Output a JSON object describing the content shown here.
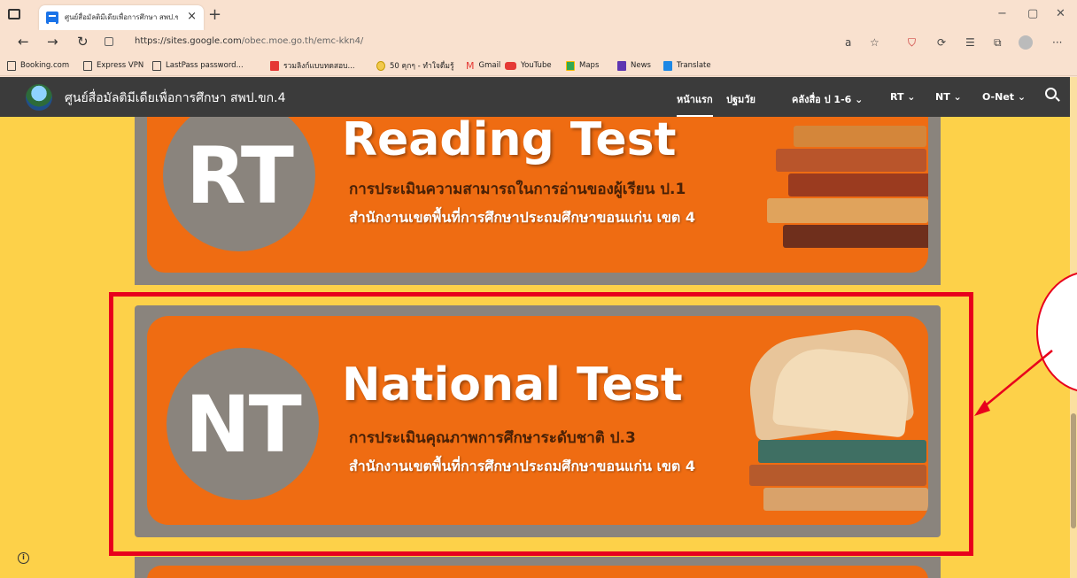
{
  "browser": {
    "tab_title": "ศูนย์สื่อมัลติมีเดียเพื่อการศึกษา สพป.ข",
    "tab_close": "×",
    "new_tab": "+",
    "url_main": "https://sites.google.com",
    "url_path": "/obec.moe.go.th/emc-kkn4/",
    "window_controls": [
      "−",
      "▢",
      "✕"
    ],
    "nav_icons": [
      "back-icon",
      "forward-icon",
      "refresh-icon"
    ],
    "toolbar_icons": [
      "read-aloud-icon",
      "favorite-icon",
      "shield-icon",
      "extension-icon",
      "collections-icon",
      "profile-icon",
      "more-icon"
    ]
  },
  "bookmarks": [
    {
      "label": "Booking.com",
      "icon": "page"
    },
    {
      "label": "Express VPN",
      "icon": "page"
    },
    {
      "label": "LastPass password...",
      "icon": "page"
    },
    {
      "label": "รวมลิงก์แบบทดสอบ...",
      "icon": "red"
    },
    {
      "label": "50 คุกๆ - ทำใจดื่มรู้",
      "icon": "coin"
    },
    {
      "label": "Gmail",
      "icon": "gmail"
    },
    {
      "label": "YouTube",
      "icon": "youtube"
    },
    {
      "label": "Maps",
      "icon": "maps"
    },
    {
      "label": "News",
      "icon": "news"
    },
    {
      "label": "Translate",
      "icon": "translate"
    }
  ],
  "site": {
    "name": "ศูนย์สื่อมัลติมีเดียเพื่อการศึกษา สพป.ขก.4",
    "nav": [
      {
        "label": "หน้าแรก",
        "active": true
      },
      {
        "label": "ปฐมวัย",
        "active": false
      },
      {
        "label": "คลังสื่อ ป 1-6 ⌄",
        "active": false
      },
      {
        "label": "RT ⌄",
        "active": false
      },
      {
        "label": "NT ⌄",
        "active": false
      },
      {
        "label": "O-Net ⌄",
        "active": false
      }
    ]
  },
  "banners": {
    "rt": {
      "abbr": "RT",
      "title": "Reading Test",
      "line1": "การประเมินความสามารถในการอ่านของผู้เรียน ป.1",
      "line2": "สำนักงานเขตพื้นที่การศึกษาประถมศึกษาขอนแก่น เขต 4"
    },
    "nt": {
      "abbr": "NT",
      "title": "National Test",
      "line1": "การประเมินคุณภาพการศึกษาระดับชาติ ป.3",
      "line2": "สำนักงานเขตพื้นที่การศึกษาประถมศึกษาขอนแก่น เขต 4"
    }
  },
  "colors": {
    "page_bg": "#fdd149",
    "header_bg": "#3b3b3b",
    "banner_orange": "#ef6c12",
    "banner_gray": "#8a847d",
    "highlight_red": "#e8001c"
  }
}
